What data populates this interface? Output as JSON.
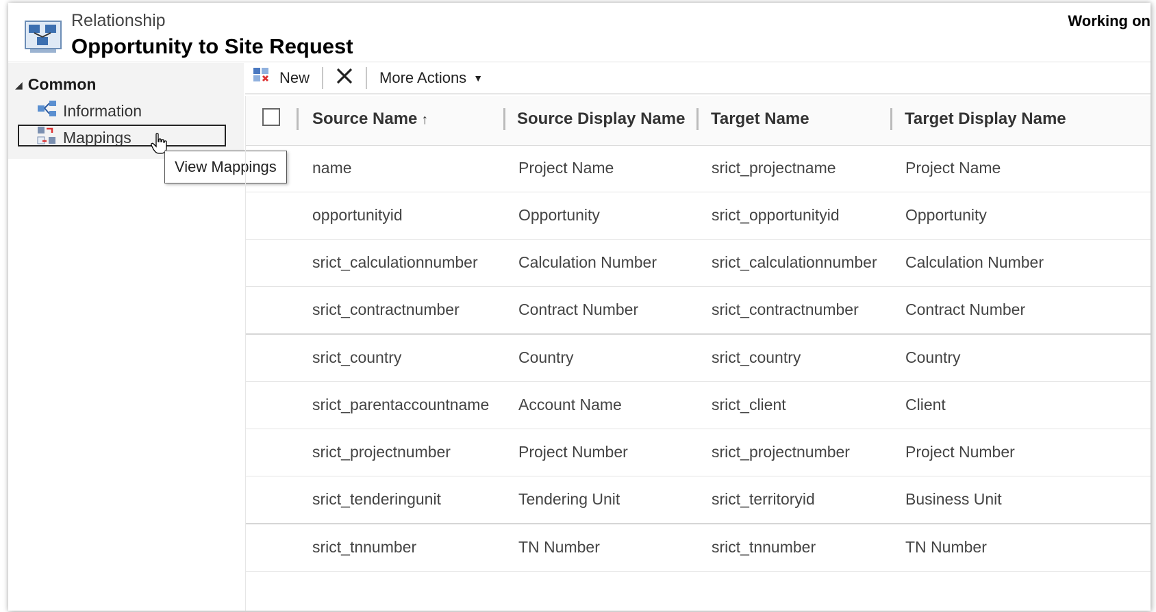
{
  "header": {
    "breadcrumb": "Relationship",
    "title": "Opportunity to Site Request",
    "status": "Working on",
    "icon": "relationship-entity-icon"
  },
  "sidebar": {
    "group_label": "Common",
    "items": [
      {
        "label": "Information",
        "icon": "information-icon"
      },
      {
        "label": "Mappings",
        "icon": "mappings-icon"
      }
    ],
    "tooltip": "View Mappings"
  },
  "toolbar": {
    "new_label": "New",
    "delete_icon": "close-icon",
    "more_actions_label": "More Actions"
  },
  "grid": {
    "columns": [
      "Source Name",
      "Source Display Name",
      "Target Name",
      "Target Display Name"
    ],
    "sort_indicator": "↑",
    "rows": [
      [
        "name",
        "Project Name",
        "srict_projectname",
        "Project Name"
      ],
      [
        "opportunityid",
        "Opportunity",
        "srict_opportunityid",
        "Opportunity"
      ],
      [
        "srict_calculationnumber",
        "Calculation Number",
        "srict_calculationnumber",
        "Calculation Number"
      ],
      [
        "srict_contractnumber",
        "Contract Number",
        "srict_contractnumber",
        "Contract Number"
      ],
      [
        "srict_country",
        "Country",
        "srict_country",
        "Country"
      ],
      [
        "srict_parentaccountname",
        "Account Name",
        "srict_client",
        "Client"
      ],
      [
        "srict_projectnumber",
        "Project Number",
        "srict_projectnumber",
        "Project Number"
      ],
      [
        "srict_tenderingunit",
        "Tendering Unit",
        "srict_territoryid",
        "Business Unit"
      ],
      [
        "srict_tnnumber",
        "TN Number",
        "srict_tnnumber",
        "TN Number"
      ]
    ]
  }
}
